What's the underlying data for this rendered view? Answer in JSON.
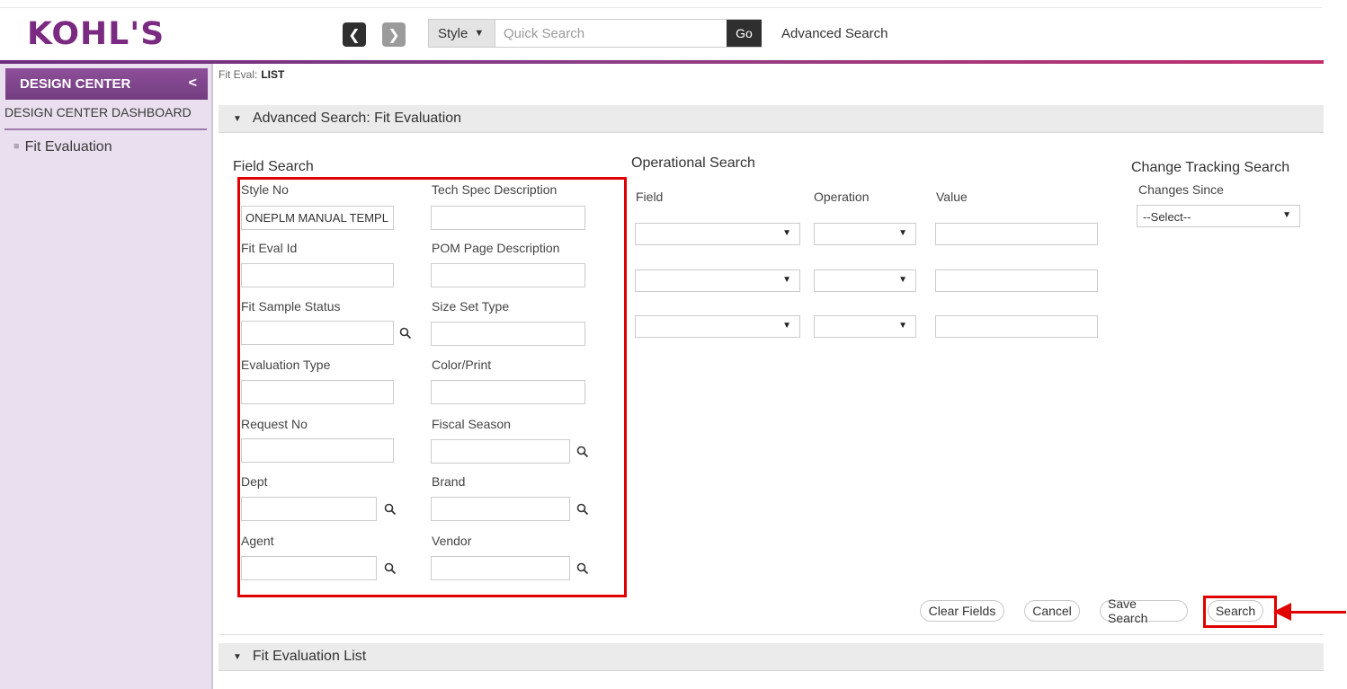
{
  "header": {
    "logo": "KOHL'S",
    "back_label": "❮",
    "forward_label": "❯",
    "search_type": "Style",
    "search_placeholder": "Quick Search",
    "go_label": "Go",
    "advanced_search_link": "Advanced Search"
  },
  "sidebar": {
    "title": "DESIGN CENTER",
    "collapse_glyph": "<",
    "dashboard": "DESIGN CENTER DASHBOARD",
    "items": [
      {
        "label": "Fit Evaluation"
      }
    ]
  },
  "breadcrumb": {
    "prefix": "Fit Eval:",
    "current": "LIST"
  },
  "advanced_section": {
    "title": "Advanced Search: Fit Evaluation",
    "field_search": {
      "title": "Field Search",
      "fields": [
        {
          "label": "Style No",
          "value": "ONEPLM MANUAL TEMPL"
        },
        {
          "label": "Tech Spec Description",
          "value": ""
        },
        {
          "label": "Fit Eval Id",
          "value": ""
        },
        {
          "label": "POM Page Description",
          "value": ""
        },
        {
          "label": "Fit Sample Status",
          "value": ""
        },
        {
          "label": "Size Set Type",
          "value": ""
        },
        {
          "label": "Evaluation Type",
          "value": ""
        },
        {
          "label": "Color/Print",
          "value": ""
        },
        {
          "label": "Request No",
          "value": ""
        },
        {
          "label": "Fiscal Season",
          "value": ""
        },
        {
          "label": "Dept",
          "value": ""
        },
        {
          "label": "Brand",
          "value": ""
        },
        {
          "label": "Agent",
          "value": ""
        },
        {
          "label": "Vendor",
          "value": ""
        }
      ]
    },
    "operational_search": {
      "title": "Operational Search",
      "col_field": "Field",
      "col_operation": "Operation",
      "col_value": "Value"
    },
    "change_tracking": {
      "title": "Change Tracking Search",
      "label": "Changes Since",
      "selected": "--Select--"
    },
    "buttons": {
      "clear": "Clear Fields",
      "cancel": "Cancel",
      "save": "Save Search",
      "search": "Search"
    }
  },
  "list_section": {
    "title": "Fit Evaluation List"
  },
  "icons": {
    "lookup": "magnifier-icon",
    "dropdown": "caret-down-icon"
  },
  "colors": {
    "brand_purple": "#7a2a80",
    "sidebar_bg": "#e9dfee",
    "annotation_red": "#e00000"
  }
}
